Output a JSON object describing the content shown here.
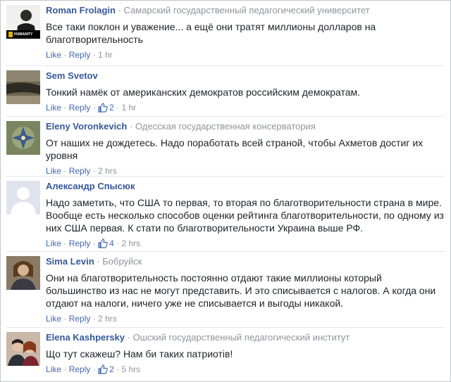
{
  "comments": [
    {
      "name": "Roman Frolagin",
      "org": "Самарский государственный педагогический университет",
      "text": "Все таки поклон и уважение... а ещё они тратят миллионы долларов на благотворительность",
      "like": "Like",
      "reply": "Reply",
      "likes": "",
      "time": "1 hr",
      "avatar_caption": "HUMANITY"
    },
    {
      "name": "Sem Svetov",
      "org": "",
      "text": "Тонкий намёк от американских демократов российским демократам.",
      "like": "Like",
      "reply": "Reply",
      "likes": "2",
      "time": "1 hr"
    },
    {
      "name": "Eleny Voronkevich",
      "org": "Одесская государственная консерватория",
      "text": "От наших не дождетесь. Надо поработать всей страной, чтобы Ахметов достиг их уровня",
      "like": "Like",
      "reply": "Reply",
      "likes": "",
      "time": "2 hrs"
    },
    {
      "name": "Александр Спысюк",
      "org": "",
      "text": "Надо заметить, что США то первая, то вторая по благотворительности страна в мире. Вообще есть несколько способов оценки рейтинга благотворительности, по одному из них США первая. К стати по благотворительности Украина выше РФ.",
      "like": "Like",
      "reply": "Reply",
      "likes": "4",
      "time": "2 hrs"
    },
    {
      "name": "Sima Levin",
      "org": "Бобруйск",
      "text": "Они на благотворительность постоянно отдают такие миллионы который большинство из нас не могут представить. И это списывается с налогов. А когда они отдают на налоги, ничего уже не списывается и выгоды никакой.",
      "like": "Like",
      "reply": "Reply",
      "likes": "",
      "time": "2 hrs"
    },
    {
      "name": "Elena Kashpersky",
      "org": "Ошский государственный педагогический институт",
      "text": "Що тут скажеш? Нам би таких патриотів!",
      "like": "Like",
      "reply": "Reply",
      "likes": "2",
      "time": "5 hrs"
    }
  ],
  "separators": {
    "dot": "·"
  },
  "colors": {
    "name": "#365899",
    "link": "#4267b2",
    "meta": "#90949c",
    "text": "#1d2129"
  }
}
